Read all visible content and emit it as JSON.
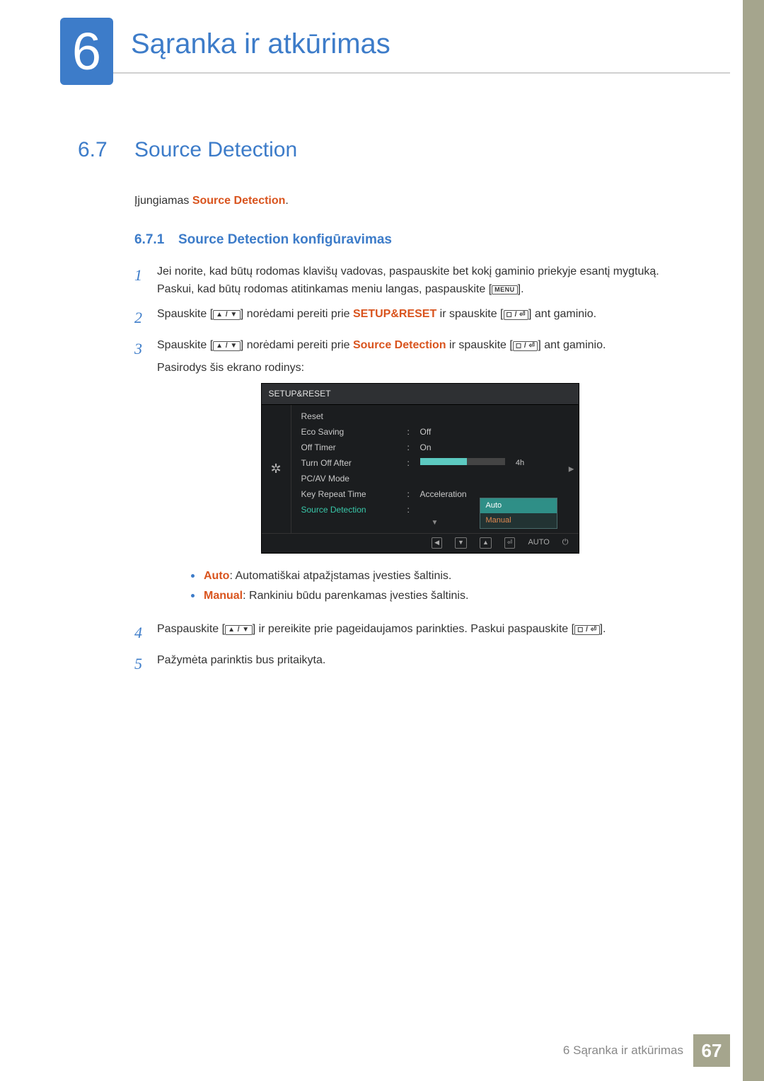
{
  "chapter": {
    "number": "6",
    "title": "Sąranka ir atkūrimas"
  },
  "section": {
    "number": "6.7",
    "title": "Source Detection"
  },
  "intro": {
    "prefix": "Įjungiamas ",
    "highlight": "Source Detection",
    "suffix": "."
  },
  "subsection": {
    "number": "6.7.1",
    "title": "Source Detection konfigūravimas"
  },
  "steps": {
    "s1": {
      "num": "1",
      "line1": "Jei norite, kad būtų rodomas klavišų vadovas, paspauskite bet kokį gaminio priekyje esantį mygtuką.",
      "line2a": "Paskui, kad būtų rodomas atitinkamas meniu langas, paspauskite [",
      "menu": "MENU",
      "line2b": "]."
    },
    "s2": {
      "num": "2",
      "a": "Spauskite [",
      "b": "] norėdami pereiti prie ",
      "hl": "SETUP&RESET",
      "c": " ir spauskite [",
      "d": "] ant gaminio."
    },
    "s3": {
      "num": "3",
      "a": "Spauskite [",
      "b": "] norėdami pereiti prie ",
      "hl": "Source Detection",
      "c": " ir spauskite [",
      "d": "] ant gaminio.",
      "tail": "Pasirodys šis ekrano rodinys:"
    },
    "s4": {
      "num": "4",
      "a": "Paspauskite [",
      "b": "] ir pereikite prie pageidaujamos parinkties. Paskui paspauskite [",
      "c": "]."
    },
    "s5": {
      "num": "5",
      "text": "Pažymėta parinktis bus pritaikyta."
    }
  },
  "bullets": {
    "auto_label": "Auto",
    "auto_text": ": Automatiškai atpažįstamas įvesties šaltinis.",
    "manual_label": "Manual",
    "manual_text": ": Rankiniu būdu parenkamas įvesties šaltinis."
  },
  "osd": {
    "title": "SETUP&RESET",
    "items": {
      "reset": "Reset",
      "eco": "Eco Saving",
      "eco_val": "Off",
      "offtimer": "Off Timer",
      "offtimer_val": "On",
      "turnoff": "Turn Off After",
      "turnoff_val": "4h",
      "pcav": "PC/AV Mode",
      "keyrep": "Key Repeat Time",
      "keyrep_val": "Acceleration",
      "srcdet": "Source Detection",
      "dd_auto": "Auto",
      "dd_manual": "Manual"
    },
    "footer": {
      "auto": "AUTO"
    }
  },
  "icons": {
    "updown": "▲ / ▼",
    "enter": "◻ / ⏎"
  },
  "footer": {
    "text": "6 Sąranka ir atkūrimas",
    "page": "67"
  }
}
